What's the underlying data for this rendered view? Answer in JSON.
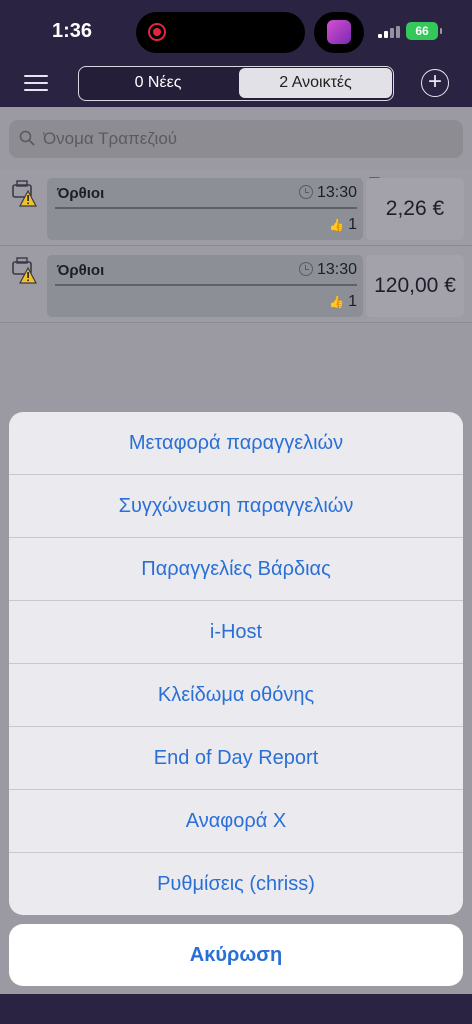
{
  "status": {
    "time": "1:36",
    "battery": "66"
  },
  "header": {
    "tab_new": "0 Νέες",
    "tab_open": "2 Ανοικτές"
  },
  "search": {
    "placeholder": "Όνομα Τραπεζιού"
  },
  "orders": [
    {
      "name": "Όρθιοι",
      "time": "13:30",
      "count": "1",
      "price": "2,26 €"
    },
    {
      "name": "Όρθιοι",
      "time": "13:30",
      "count": "1",
      "price": "120,00 €"
    }
  ],
  "action_sheet": {
    "items": [
      "Μεταφορά παραγγελιών",
      "Συγχώνευση παραγγελιών",
      "Παραγγελίες Βάρδιας",
      "i-Host",
      "Κλείδωμα οθόνης",
      "End of Day Report",
      "Αναφορά Χ",
      "Ρυθμίσεις (chriss)"
    ],
    "cancel": "Ακύρωση"
  },
  "colors": {
    "header_bg": "#2a2342",
    "action_blue": "#2a6fd6",
    "battery_green": "#34c759",
    "warning_yellow": "#f2c12e"
  }
}
